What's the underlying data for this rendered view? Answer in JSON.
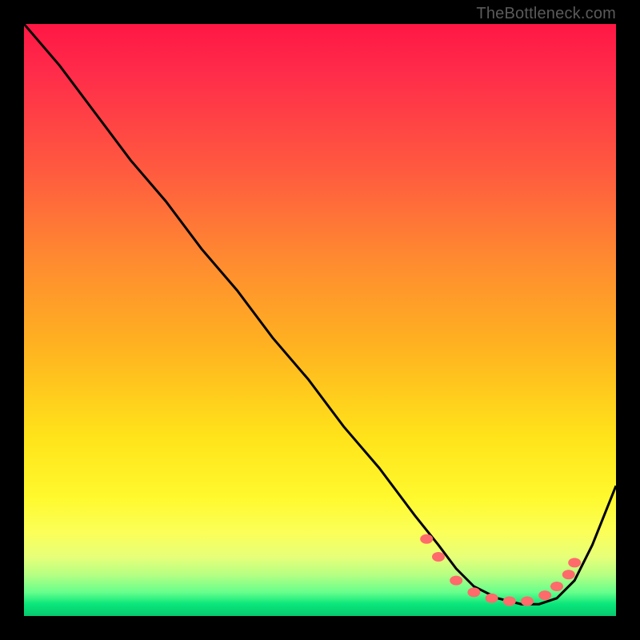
{
  "watermark": "TheBottleneck.com",
  "chart_data": {
    "type": "line",
    "title": "",
    "xlabel": "",
    "ylabel": "",
    "xlim": [
      0,
      100
    ],
    "ylim": [
      0,
      100
    ],
    "grid": false,
    "legend": false,
    "series": [
      {
        "name": "curve",
        "x": [
          0,
          6,
          12,
          18,
          24,
          30,
          36,
          42,
          48,
          54,
          60,
          66,
          70,
          73,
          76,
          80,
          84,
          87,
          90,
          93,
          96,
          100
        ],
        "y": [
          100,
          93,
          85,
          77,
          70,
          62,
          55,
          47,
          40,
          32,
          25,
          17,
          12,
          8,
          5,
          3,
          2,
          2,
          3,
          6,
          12,
          22
        ]
      }
    ],
    "markers": [
      {
        "x": 68,
        "y": 13
      },
      {
        "x": 70,
        "y": 10
      },
      {
        "x": 73,
        "y": 6
      },
      {
        "x": 76,
        "y": 4
      },
      {
        "x": 79,
        "y": 3
      },
      {
        "x": 82,
        "y": 2.5
      },
      {
        "x": 85,
        "y": 2.5
      },
      {
        "x": 88,
        "y": 3.5
      },
      {
        "x": 90,
        "y": 5
      },
      {
        "x": 92,
        "y": 7
      },
      {
        "x": 93,
        "y": 9
      }
    ]
  }
}
